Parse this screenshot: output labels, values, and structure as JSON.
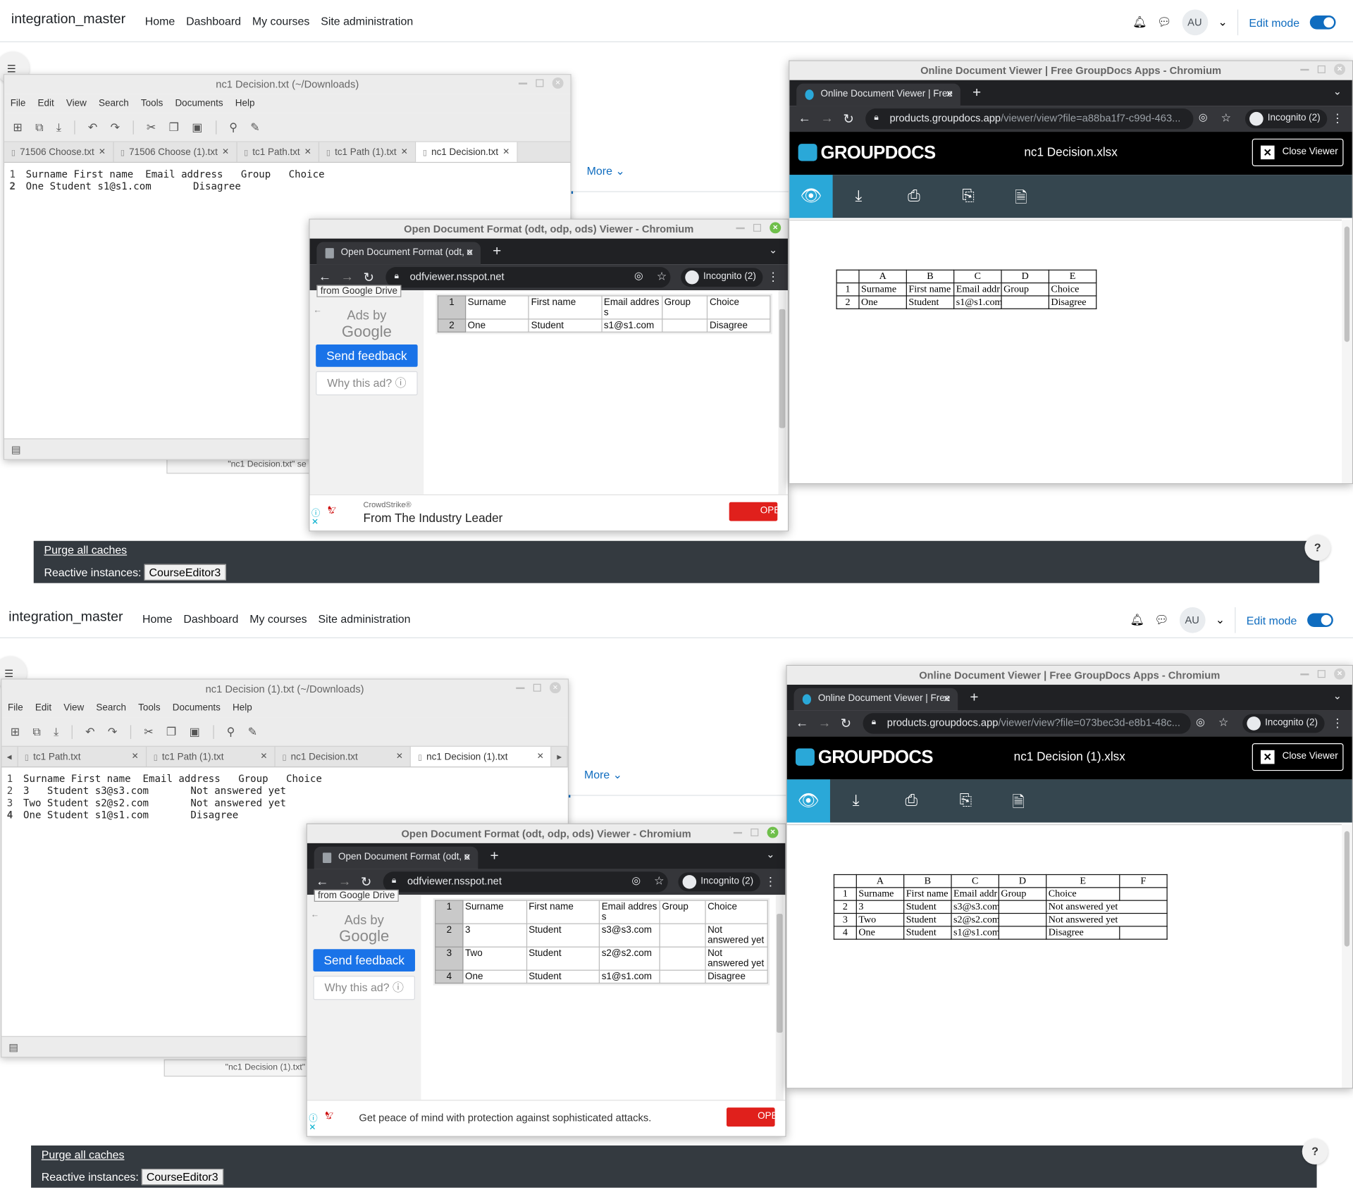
{
  "moodle": {
    "brand": "integration_master",
    "nav": [
      "Home",
      "Dashboard",
      "My courses",
      "Site administration"
    ],
    "avatar": "AU",
    "edit_mode": "Edit mode",
    "more": "More",
    "purge": "Purge all caches",
    "reactive_label": "Reactive instances:",
    "reactive_btn": "CourseEditor3",
    "help": "?"
  },
  "gedit": {
    "menu": [
      "File",
      "Edit",
      "View",
      "Search",
      "Tools",
      "Documents",
      "Help"
    ]
  },
  "odf": {
    "title": "Open Document Format (odt, odp, ods) Viewer - Chromium",
    "tab": "Open Document Format (odt, o",
    "url": "odfviewer.nsspot.net",
    "incognito": "Incognito (2)",
    "gdrive": "from Google Drive",
    "ads_by": "Ads by",
    "google": "Google",
    "send_feedback": "Send feedback",
    "why_ad": "Why this ad? ⓘ",
    "ad_open": "OPE"
  },
  "gd": {
    "title": "Online Document Viewer | Free GroupDocs Apps - Chromium",
    "tab": "Online Document Viewer | Free",
    "incognito": "Incognito (2)",
    "logo": "GROUPDOCS",
    "close": "Close Viewer",
    "cols": [
      "A",
      "B",
      "C",
      "D",
      "E"
    ]
  },
  "top": {
    "gedit_title": "nc1 Decision.txt (~/Downloads)",
    "tabs": [
      "71506 Choose.txt",
      "71506 Choose (1).txt",
      "tc1 Path.txt",
      "tc1 Path (1).txt",
      "nc1 Decision.txt"
    ],
    "lines": [
      "Surname First name  Email address   Group   Choice",
      "One Student s1@s1.com       Disagree"
    ],
    "behind": "\"nc1 Decision.txt\" se",
    "odf_rows": [
      [
        "1",
        "Surname",
        "First name",
        "Email addres s",
        "Group",
        "Choice"
      ],
      [
        "2",
        "One",
        "Student",
        "s1@s1.com",
        "",
        "Disagree"
      ]
    ],
    "ad_source": "CrowdStrike®",
    "ad_text": "From The Industry Leader",
    "gd_url_main": "products.groupdocs.app",
    "gd_url_rest": "/viewer/view?file=a88ba1f7-c99d-463...",
    "gd_file": "nc1 Decision.xlsx",
    "gd_cols": [
      "",
      "A",
      "B",
      "C",
      "D",
      "E"
    ],
    "gd_rows": [
      [
        "1",
        "Surname",
        "First name",
        "Email addr",
        "Group",
        "Choice"
      ],
      [
        "2",
        "One",
        "Student",
        "s1@s1.com",
        "",
        "Disagree"
      ]
    ]
  },
  "bottom": {
    "gedit_title": "nc1 Decision (1).txt (~/Downloads)",
    "tabs": [
      "tc1 Path.txt",
      "tc1 Path (1).txt",
      "nc1 Decision.txt",
      "nc1 Decision (1).txt"
    ],
    "lines": [
      "Surname First name  Email address   Group   Choice",
      "3   Student s3@s3.com       Not answered yet",
      "Two Student s2@s2.com       Not answered yet",
      "One Student s1@s1.com       Disagree"
    ],
    "behind": "\"nc1 Decision (1).txt\" s",
    "odf_rows": [
      [
        "1",
        "Surname",
        "First name",
        "Email addres s",
        "Group",
        "Choice"
      ],
      [
        "2",
        "3",
        "Student",
        "s3@s3.com",
        "",
        "Not answered yet"
      ],
      [
        "3",
        "Two",
        "Student",
        "s2@s2.com",
        "",
        "Not answered yet"
      ],
      [
        "4",
        "One",
        "Student",
        "s1@s1.com",
        "",
        "Disagree"
      ]
    ],
    "ad_text": "Get peace of mind with protection against sophisticated attacks.",
    "gd_url_main": "products.groupdocs.app",
    "gd_url_rest": "/viewer/view?file=073bec3d-e8b1-48c...",
    "gd_file": "nc1 Decision (1).xlsx",
    "gd_cols": [
      "",
      "A",
      "B",
      "C",
      "D",
      "E",
      "F"
    ],
    "gd_rows": [
      [
        "1",
        "Surname",
        "First name",
        "Email addr",
        "Group",
        "Choice",
        ""
      ],
      [
        "2",
        "3",
        "Student",
        "s3@s3.com",
        "",
        "Not answered yet",
        ""
      ],
      [
        "3",
        "Two",
        "Student",
        "s2@s2.com",
        "",
        "Not answered yet",
        ""
      ],
      [
        "4",
        "One",
        "Student",
        "s1@s1.com",
        "",
        "Disagree",
        ""
      ]
    ]
  }
}
